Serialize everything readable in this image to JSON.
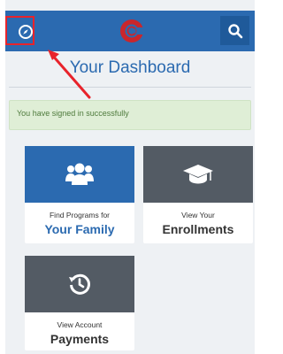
{
  "header": {
    "nav_icon": "compass-icon",
    "logo_icon": "c-logo-icon",
    "search_icon": "search-icon",
    "bar_color": "#2b6ab0"
  },
  "dashboard": {
    "title": "Your Dashboard",
    "alert": "You have signed in successfully"
  },
  "tiles": [
    {
      "icon": "group-icon",
      "sub": "Find Programs for",
      "main": "Your Family"
    },
    {
      "icon": "graduation-cap-icon",
      "sub": "View Your",
      "main": "Enrollments"
    },
    {
      "icon": "history-icon",
      "sub": "View Account",
      "main": "Payments"
    }
  ],
  "annotation": {
    "color": "#e8232b"
  }
}
